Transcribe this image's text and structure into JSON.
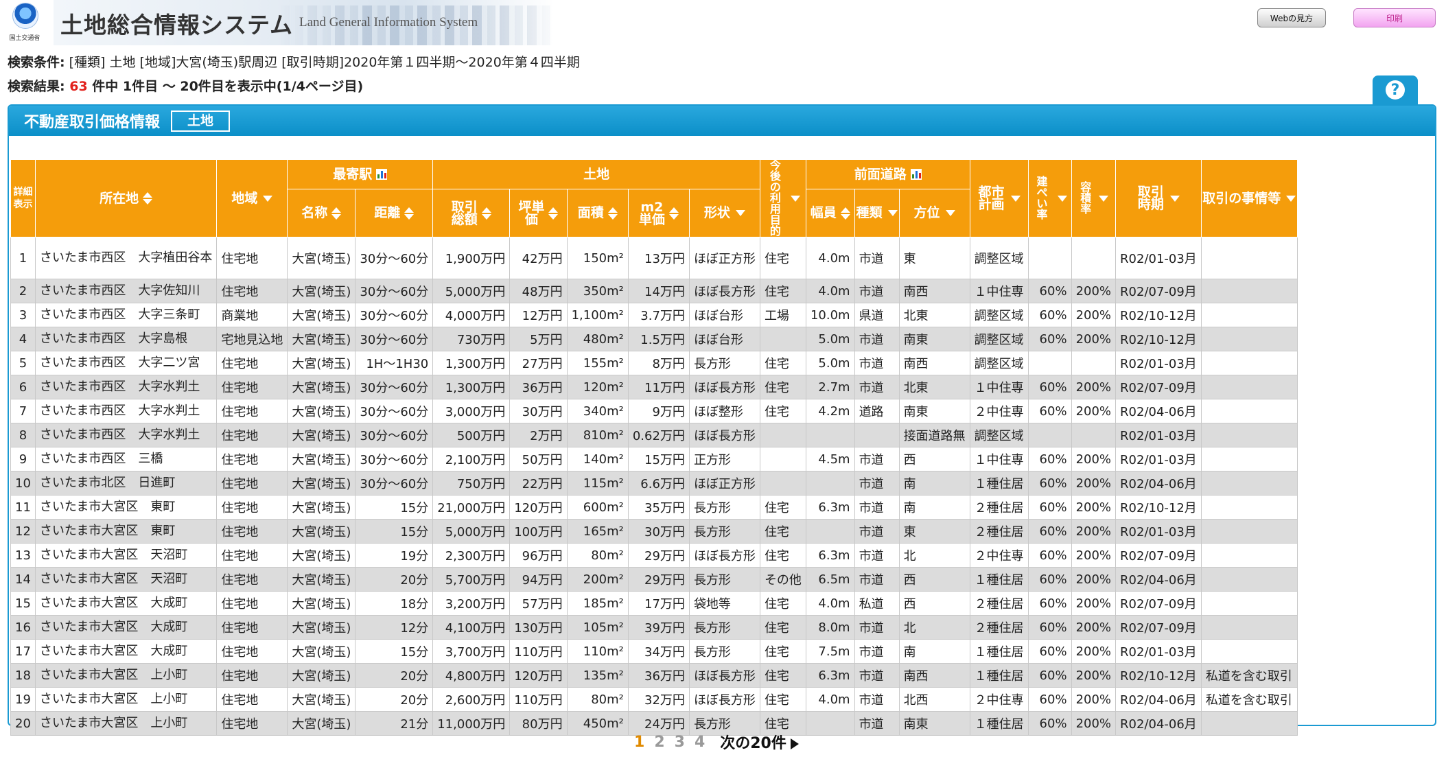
{
  "header": {
    "logo_caption": "国土交通省",
    "title": "土地総合情報システム",
    "subtitle": "Land General Information System",
    "help_button": "Webの見方",
    "print_button": "印刷"
  },
  "search": {
    "conditions_label": "検索条件:",
    "conditions": " [種類] 土地 [地域]大宮(埼玉)駅周辺 [取引時期]2020年第１四半期～2020年第４四半期",
    "result_label": "検索結果: ",
    "result_count": "63",
    "result_suffix": " 件中 1件目 ～ 20件目を表示中(1/4ページ目)",
    "help_icon": "?"
  },
  "panel": {
    "title": "不動産取引価格情報",
    "tag": "土地"
  },
  "table": {
    "headers": {
      "detail": "詳細表示",
      "location": "所在地",
      "area": "地域",
      "station_group": "最寄駅",
      "station_name": "名称",
      "station_distance": "距離",
      "land_group": "土地",
      "total_price": "取引総額",
      "tsubo_price": "坪単価",
      "area_size": "面積",
      "m2_price_a": "m2",
      "m2_price_b": "単価",
      "shape": "形状",
      "future_use": "今後の利用目的",
      "road_group": "前面道路",
      "road_width": "幅員",
      "road_type": "種類",
      "road_direction": "方位",
      "city_plan": "都市計画",
      "coverage": "建ぺい率",
      "far": "容積率",
      "period": "取引時期",
      "circumstances": "取引の事情等"
    },
    "rows": [
      {
        "no": "1",
        "loc": "さいたま市西区　大字植田谷本",
        "area": "住宅地",
        "st": "大宮(埼玉)",
        "dist": "30分～60分",
        "total": "1,900万円",
        "tsubo": "42万円",
        "size": "150m²",
        "m2": "13万円",
        "shape": "ほぼ正方形",
        "use": "住宅",
        "width": "4.0m",
        "rtype": "市道",
        "dir": "東",
        "plan": "調整区域",
        "cov": "",
        "far": "",
        "period": "R02/01-03月",
        "note": ""
      },
      {
        "no": "2",
        "loc": "さいたま市西区　大字佐知川",
        "area": "住宅地",
        "st": "大宮(埼玉)",
        "dist": "30分～60分",
        "total": "5,000万円",
        "tsubo": "48万円",
        "size": "350m²",
        "m2": "14万円",
        "shape": "ほぼ長方形",
        "use": "住宅",
        "width": "4.0m",
        "rtype": "市道",
        "dir": "南西",
        "plan": "１中住専",
        "cov": "60%",
        "far": "200%",
        "period": "R02/07-09月",
        "note": ""
      },
      {
        "no": "3",
        "loc": "さいたま市西区　大字三条町",
        "area": "商業地",
        "st": "大宮(埼玉)",
        "dist": "30分～60分",
        "total": "4,000万円",
        "tsubo": "12万円",
        "size": "1,100m²",
        "m2": "3.7万円",
        "shape": "ほぼ台形",
        "use": "工場",
        "width": "10.0m",
        "rtype": "県道",
        "dir": "北東",
        "plan": "調整区域",
        "cov": "60%",
        "far": "200%",
        "period": "R02/10-12月",
        "note": ""
      },
      {
        "no": "4",
        "loc": "さいたま市西区　大字島根",
        "area": "宅地見込地",
        "st": "大宮(埼玉)",
        "dist": "30分～60分",
        "total": "730万円",
        "tsubo": "5万円",
        "size": "480m²",
        "m2": "1.5万円",
        "shape": "ほぼ台形",
        "use": "",
        "width": "5.0m",
        "rtype": "市道",
        "dir": "南東",
        "plan": "調整区域",
        "cov": "60%",
        "far": "200%",
        "period": "R02/10-12月",
        "note": ""
      },
      {
        "no": "5",
        "loc": "さいたま市西区　大字二ツ宮",
        "area": "住宅地",
        "st": "大宮(埼玉)",
        "dist": "1H～1H30",
        "total": "1,300万円",
        "tsubo": "27万円",
        "size": "155m²",
        "m2": "8万円",
        "shape": "長方形",
        "use": "住宅",
        "width": "5.0m",
        "rtype": "市道",
        "dir": "南西",
        "plan": "調整区域",
        "cov": "",
        "far": "",
        "period": "R02/01-03月",
        "note": ""
      },
      {
        "no": "6",
        "loc": "さいたま市西区　大字水判土",
        "area": "住宅地",
        "st": "大宮(埼玉)",
        "dist": "30分～60分",
        "total": "1,300万円",
        "tsubo": "36万円",
        "size": "120m²",
        "m2": "11万円",
        "shape": "ほぼ長方形",
        "use": "住宅",
        "width": "2.7m",
        "rtype": "市道",
        "dir": "北東",
        "plan": "１中住専",
        "cov": "60%",
        "far": "200%",
        "period": "R02/07-09月",
        "note": ""
      },
      {
        "no": "7",
        "loc": "さいたま市西区　大字水判土",
        "area": "住宅地",
        "st": "大宮(埼玉)",
        "dist": "30分～60分",
        "total": "3,000万円",
        "tsubo": "30万円",
        "size": "340m²",
        "m2": "9万円",
        "shape": "ほぼ整形",
        "use": "住宅",
        "width": "4.2m",
        "rtype": "道路",
        "dir": "南東",
        "plan": "２中住専",
        "cov": "60%",
        "far": "200%",
        "period": "R02/04-06月",
        "note": ""
      },
      {
        "no": "8",
        "loc": "さいたま市西区　大字水判土",
        "area": "住宅地",
        "st": "大宮(埼玉)",
        "dist": "30分～60分",
        "total": "500万円",
        "tsubo": "2万円",
        "size": "810m²",
        "m2": "0.62万円",
        "shape": "ほぼ長方形",
        "use": "",
        "width": "",
        "rtype": "",
        "dir": "接面道路無",
        "plan": "調整区域",
        "cov": "",
        "far": "",
        "period": "R02/01-03月",
        "note": ""
      },
      {
        "no": "9",
        "loc": "さいたま市西区　三橋",
        "area": "住宅地",
        "st": "大宮(埼玉)",
        "dist": "30分～60分",
        "total": "2,100万円",
        "tsubo": "50万円",
        "size": "140m²",
        "m2": "15万円",
        "shape": "正方形",
        "use": "",
        "width": "4.5m",
        "rtype": "市道",
        "dir": "西",
        "plan": "１中住専",
        "cov": "60%",
        "far": "200%",
        "period": "R02/01-03月",
        "note": ""
      },
      {
        "no": "10",
        "loc": "さいたま市北区　日進町",
        "area": "住宅地",
        "st": "大宮(埼玉)",
        "dist": "30分～60分",
        "total": "750万円",
        "tsubo": "22万円",
        "size": "115m²",
        "m2": "6.6万円",
        "shape": "ほぼ正方形",
        "use": "",
        "width": "",
        "rtype": "市道",
        "dir": "南",
        "plan": "１種住居",
        "cov": "60%",
        "far": "200%",
        "period": "R02/04-06月",
        "note": ""
      },
      {
        "no": "11",
        "loc": "さいたま市大宮区　東町",
        "area": "住宅地",
        "st": "大宮(埼玉)",
        "dist": "15分",
        "total": "21,000万円",
        "tsubo": "120万円",
        "size": "600m²",
        "m2": "35万円",
        "shape": "長方形",
        "use": "住宅",
        "width": "6.3m",
        "rtype": "市道",
        "dir": "南",
        "plan": "２種住居",
        "cov": "60%",
        "far": "200%",
        "period": "R02/10-12月",
        "note": ""
      },
      {
        "no": "12",
        "loc": "さいたま市大宮区　東町",
        "area": "住宅地",
        "st": "大宮(埼玉)",
        "dist": "15分",
        "total": "5,000万円",
        "tsubo": "100万円",
        "size": "165m²",
        "m2": "30万円",
        "shape": "長方形",
        "use": "住宅",
        "width": "",
        "rtype": "市道",
        "dir": "東",
        "plan": "２種住居",
        "cov": "60%",
        "far": "200%",
        "period": "R02/01-03月",
        "note": ""
      },
      {
        "no": "13",
        "loc": "さいたま市大宮区　天沼町",
        "area": "住宅地",
        "st": "大宮(埼玉)",
        "dist": "19分",
        "total": "2,300万円",
        "tsubo": "96万円",
        "size": "80m²",
        "m2": "29万円",
        "shape": "ほぼ長方形",
        "use": "住宅",
        "width": "6.3m",
        "rtype": "市道",
        "dir": "北",
        "plan": "２中住専",
        "cov": "60%",
        "far": "200%",
        "period": "R02/07-09月",
        "note": ""
      },
      {
        "no": "14",
        "loc": "さいたま市大宮区　天沼町",
        "area": "住宅地",
        "st": "大宮(埼玉)",
        "dist": "20分",
        "total": "5,700万円",
        "tsubo": "94万円",
        "size": "200m²",
        "m2": "29万円",
        "shape": "長方形",
        "use": "その他",
        "width": "6.5m",
        "rtype": "市道",
        "dir": "西",
        "plan": "１種住居",
        "cov": "60%",
        "far": "200%",
        "period": "R02/04-06月",
        "note": ""
      },
      {
        "no": "15",
        "loc": "さいたま市大宮区　大成町",
        "area": "住宅地",
        "st": "大宮(埼玉)",
        "dist": "18分",
        "total": "3,200万円",
        "tsubo": "57万円",
        "size": "185m²",
        "m2": "17万円",
        "shape": "袋地等",
        "use": "住宅",
        "width": "4.0m",
        "rtype": "私道",
        "dir": "西",
        "plan": "２種住居",
        "cov": "60%",
        "far": "200%",
        "period": "R02/07-09月",
        "note": ""
      },
      {
        "no": "16",
        "loc": "さいたま市大宮区　大成町",
        "area": "住宅地",
        "st": "大宮(埼玉)",
        "dist": "12分",
        "total": "4,100万円",
        "tsubo": "130万円",
        "size": "105m²",
        "m2": "39万円",
        "shape": "長方形",
        "use": "住宅",
        "width": "8.0m",
        "rtype": "市道",
        "dir": "北",
        "plan": "２種住居",
        "cov": "60%",
        "far": "200%",
        "period": "R02/07-09月",
        "note": ""
      },
      {
        "no": "17",
        "loc": "さいたま市大宮区　大成町",
        "area": "住宅地",
        "st": "大宮(埼玉)",
        "dist": "15分",
        "total": "3,700万円",
        "tsubo": "110万円",
        "size": "110m²",
        "m2": "34万円",
        "shape": "長方形",
        "use": "住宅",
        "width": "7.5m",
        "rtype": "市道",
        "dir": "南",
        "plan": "１種住居",
        "cov": "60%",
        "far": "200%",
        "period": "R02/01-03月",
        "note": ""
      },
      {
        "no": "18",
        "loc": "さいたま市大宮区　上小町",
        "area": "住宅地",
        "st": "大宮(埼玉)",
        "dist": "20分",
        "total": "4,800万円",
        "tsubo": "120万円",
        "size": "135m²",
        "m2": "36万円",
        "shape": "ほぼ長方形",
        "use": "住宅",
        "width": "6.3m",
        "rtype": "市道",
        "dir": "南西",
        "plan": "１種住居",
        "cov": "60%",
        "far": "200%",
        "period": "R02/10-12月",
        "note": "私道を含む取引"
      },
      {
        "no": "19",
        "loc": "さいたま市大宮区　上小町",
        "area": "住宅地",
        "st": "大宮(埼玉)",
        "dist": "20分",
        "total": "2,600万円",
        "tsubo": "110万円",
        "size": "80m²",
        "m2": "32万円",
        "shape": "ほぼ長方形",
        "use": "住宅",
        "width": "4.0m",
        "rtype": "市道",
        "dir": "北西",
        "plan": "２中住専",
        "cov": "60%",
        "far": "200%",
        "period": "R02/04-06月",
        "note": "私道を含む取引"
      },
      {
        "no": "20",
        "loc": "さいたま市大宮区　上小町",
        "area": "住宅地",
        "st": "大宮(埼玉)",
        "dist": "21分",
        "total": "11,000万円",
        "tsubo": "80万円",
        "size": "450m²",
        "m2": "24万円",
        "shape": "長方形",
        "use": "住宅",
        "width": "",
        "rtype": "市道",
        "dir": "南東",
        "plan": "１種住居",
        "cov": "60%",
        "far": "200%",
        "period": "R02/04-06月",
        "note": ""
      }
    ]
  },
  "pager": {
    "current": "1",
    "pages": [
      "2",
      "3",
      "4"
    ],
    "next_label": "次の20件"
  },
  "colors": {
    "accent_blue": "#1a9ad2",
    "header_orange": "#f59d0b",
    "link_blue": "#1a73d9",
    "count_red": "#e2211c"
  }
}
